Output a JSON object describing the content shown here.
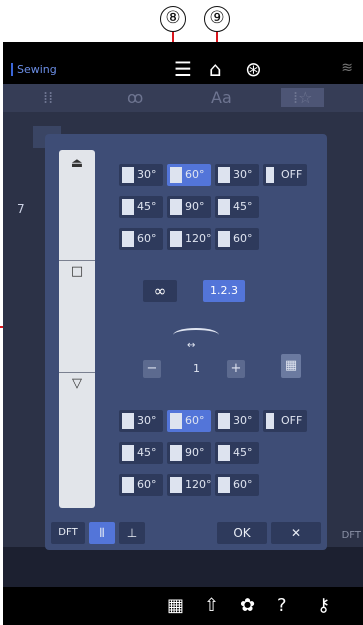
{
  "callouts": {
    "c8": "⑧",
    "c9": "⑨"
  },
  "topbar": {
    "app_label": "Sewing"
  },
  "tabs": [
    "⁞⁞",
    "ꝏ",
    "Aa",
    "⁞☆"
  ],
  "side_fragments": {
    "left_top": "7",
    "right_mid": "DFT"
  },
  "dialog": {
    "upper_group": [
      [
        "30°",
        "60°",
        "30°",
        "OFF"
      ],
      [
        "45°",
        "90°",
        "45°"
      ],
      [
        "60°",
        "120°",
        "60°"
      ]
    ],
    "upper_selected": "60°",
    "mid": {
      "continuous_label": "∞",
      "count_label": "1.2.3",
      "minus": "−",
      "plus": "+",
      "value": "1"
    },
    "lower_group": [
      [
        "30°",
        "60°",
        "30°",
        "OFF"
      ],
      [
        "45°",
        "90°",
        "45°"
      ],
      [
        "60°",
        "120°",
        "60°"
      ]
    ],
    "lower_selected": "60°",
    "footer": {
      "dft": "DFT",
      "ok": "OK",
      "close": "✕"
    }
  },
  "colors": {
    "accent": "#5375d9",
    "dialog_bg": "#3e4d76",
    "callout_line": "#d9161d"
  }
}
